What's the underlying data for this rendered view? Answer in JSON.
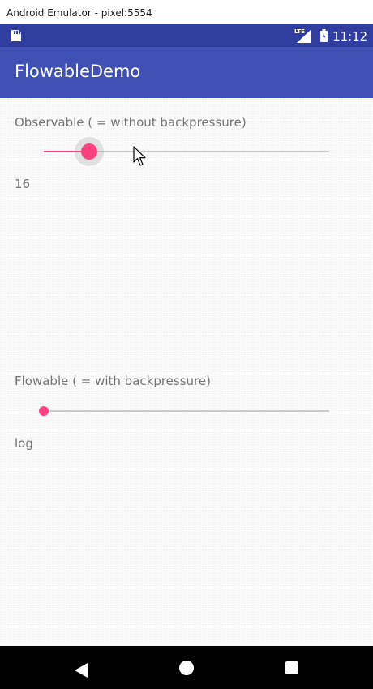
{
  "window": {
    "title": "Android Emulator - pixel:5554"
  },
  "status_bar": {
    "background": "#303f9f",
    "network_label": "LTE",
    "time": "11:12",
    "icons": [
      "sd-card-icon",
      "signal-icon",
      "battery-icon"
    ]
  },
  "app_bar": {
    "title": "FlowableDemo",
    "background": "#3f51b5"
  },
  "observable_section": {
    "label": "Observable ( = without backpressure)",
    "slider_fraction": 0.16,
    "slider_pressed": true,
    "value_text": "16"
  },
  "flowable_section": {
    "label": "Flowable ( = with backpressure)",
    "slider_fraction": 0.0,
    "slider_pressed": false,
    "value_text": "log"
  },
  "accent_color": "#ff4081",
  "nav_bar": {
    "buttons": [
      "back-icon",
      "home-icon",
      "recents-icon"
    ]
  }
}
